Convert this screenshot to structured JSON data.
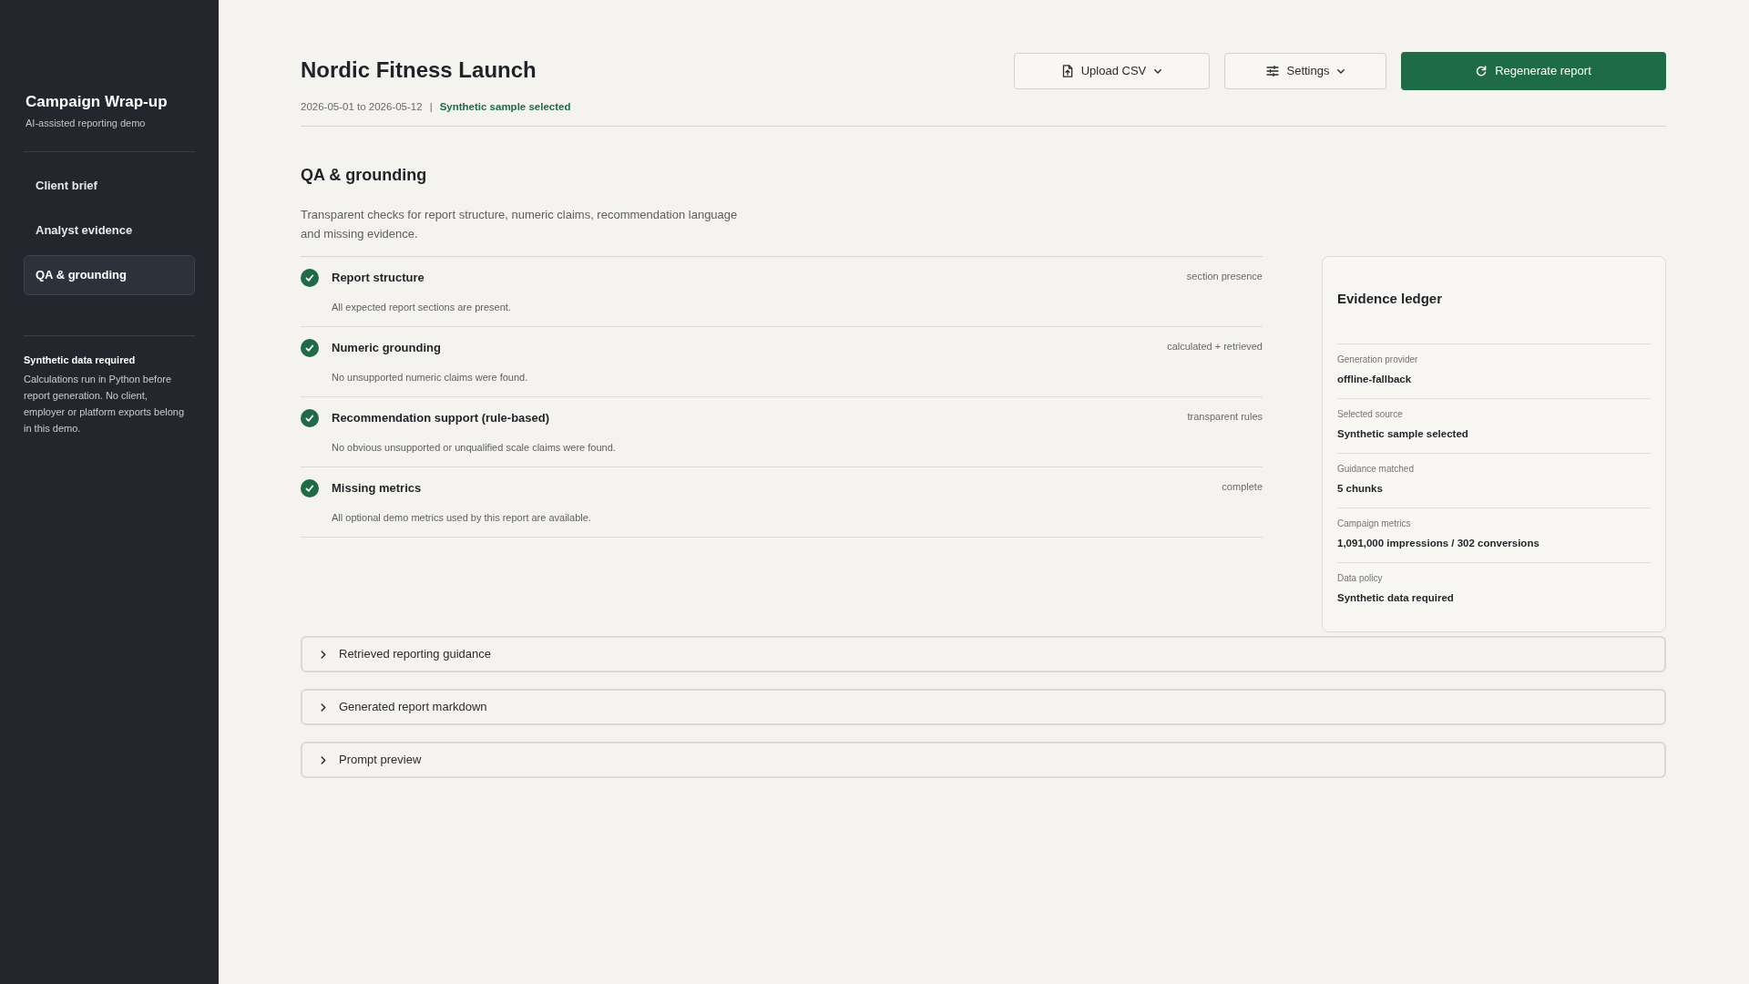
{
  "sidebar": {
    "title": "Campaign Wrap-up",
    "subtitle": "AI-assisted reporting demo",
    "nav": [
      {
        "label": "Client brief",
        "selected": false
      },
      {
        "label": "Analyst evidence",
        "selected": false
      },
      {
        "label": "QA & grounding",
        "selected": true
      }
    ],
    "note": {
      "title": "Synthetic data required",
      "text": "Calculations run in Python before report generation. No client, employer or platform exports belong in this demo."
    }
  },
  "header": {
    "title": "Nordic Fitness Launch",
    "date_range": "2026-05-01 to 2026-05-12",
    "separator": "|",
    "source_status": "Synthetic sample selected",
    "buttons": [
      {
        "kind": "upload",
        "label": "Upload CSV"
      },
      {
        "kind": "settings",
        "label": "Settings"
      },
      {
        "kind": "regenerate",
        "label": "Regenerate report"
      }
    ]
  },
  "qa": {
    "heading": "QA & grounding",
    "description": "Transparent checks for report structure, numeric claims, recommendation language and missing evidence.",
    "checks": [
      {
        "title": "Report structure",
        "description": "All expected report sections are present.",
        "tag": "section presence",
        "passed": true
      },
      {
        "title": "Numeric grounding",
        "description": "No unsupported numeric claims were found.",
        "tag": "calculated + retrieved",
        "passed": true
      },
      {
        "title": "Recommendation support (rule-based)",
        "description": "No obvious unsupported or unqualified scale claims were found.",
        "tag": "transparent rules",
        "passed": true
      },
      {
        "title": "Missing metrics",
        "description": "All optional demo metrics used by this report are available.",
        "tag": "complete",
        "passed": true
      }
    ]
  },
  "evidence_ledger": {
    "title": "Evidence ledger",
    "items": [
      {
        "label": "Generation provider",
        "value": "offline-fallback"
      },
      {
        "label": "Selected source",
        "value": "Synthetic sample selected"
      },
      {
        "label": "Guidance matched",
        "value": "5 chunks"
      },
      {
        "label": "Campaign metrics",
        "value": "1,091,000 impressions / 302 conversions"
      },
      {
        "label": "Data policy",
        "value": "Synthetic data required"
      }
    ]
  },
  "accordions": [
    {
      "label": "Retrieved reporting guidance",
      "expanded": false
    },
    {
      "label": "Generated report markdown",
      "expanded": false
    },
    {
      "label": "Prompt preview",
      "expanded": false
    }
  ]
}
